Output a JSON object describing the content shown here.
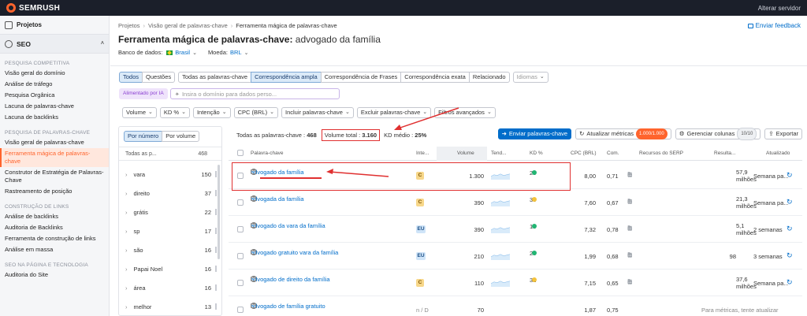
{
  "topbar": {
    "brand": "SEMRUSH",
    "server_label": "Alterar servidor"
  },
  "sidebar": {
    "projects": "Projetos",
    "seo": "SEO",
    "sections": [
      {
        "title": "PESQUISA COMPETITIVA",
        "items": [
          "Visão geral do domínio",
          "Análise de tráfego",
          "Pesquisa Orgânica",
          "Lacuna de palavras-chave",
          "Lacuna de backlinks"
        ]
      },
      {
        "title": "PESQUISA DE PALAVRAS-CHAVE",
        "items": [
          "Visão geral de palavras-chave",
          "Ferramenta mágica de palavras-chave",
          "Construtor de Estratégia de Palavras-Chave",
          "Rastreamento de posição"
        ]
      },
      {
        "title": "CONSTRUÇÃO DE LINKS",
        "items": [
          "Análise de backlinks",
          "Auditoria de Backlinks",
          "Ferramenta de construção de links",
          "Análise em massa"
        ]
      },
      {
        "title": "SEO NA PÁGINA E TECNOLOGIA",
        "items": [
          "Auditoria do Site"
        ]
      }
    ]
  },
  "header": {
    "breadcrumbs": [
      "Projetos",
      "Visão geral de palavras-chave",
      "Ferramenta mágica de palavras-chave"
    ],
    "feedback": "Enviar feedback",
    "title": "Ferramenta mágica de palavras-chave:",
    "keyword": "advogado da família",
    "db_label": "Banco de dados:",
    "db_value": "Brasil",
    "currency_label": "Moeda:",
    "currency_value": "BRL"
  },
  "filters": {
    "group1": [
      "Todos",
      "Questões"
    ],
    "group2": [
      "Todas as palavras-chave",
      "Correspondência ampla",
      "Correspondência de Frases",
      "Correspondência exata",
      "Relacionado"
    ],
    "languages": "Idiomas",
    "ai_badge": "Alimentado por IA",
    "ai_placeholder": "Insira o domínio para dados perso...",
    "row2": [
      "Volume",
      "KD %",
      "Intenção",
      "CPC (BRL)",
      "Incluir palavras-chave",
      "Excluir palavras-chave",
      "Filtros avançados"
    ]
  },
  "left_panel": {
    "toggle": [
      "Por número",
      "Por volume"
    ],
    "head_label": "Todas as p...",
    "head_count": "468",
    "items": [
      {
        "label": "vara",
        "count": "150"
      },
      {
        "label": "direito",
        "count": "37"
      },
      {
        "label": "grátis",
        "count": "22"
      },
      {
        "label": "sp",
        "count": "17"
      },
      {
        "label": "são",
        "count": "16"
      },
      {
        "label": "Papai Noel",
        "count": "16"
      },
      {
        "label": "área",
        "count": "16"
      },
      {
        "label": "melhor",
        "count": "13"
      }
    ]
  },
  "table": {
    "total_label": "Todas as palavras-chave :",
    "total_value": "468",
    "volume_label": "Volume total :",
    "volume_value": "3.160",
    "kd_label": "KD médio :",
    "kd_value": "25%",
    "send_button": "Enviar palavras-chave",
    "update_button": "Atualizar métricas",
    "update_badge": "1.000/1.000",
    "columns_button": "Gerenciar colunas",
    "columns_badge": "10/10",
    "export_button": "Exportar",
    "headers": [
      "Palavra-chave",
      "Inte...",
      "Volume",
      "Tend...",
      "KD %",
      "CPC (BRL)",
      "Com.",
      "Recursos do SERP",
      "Resulta...",
      "Atualizado"
    ],
    "rows": [
      {
        "keyword": "advogado da família",
        "intent": "C",
        "volume": "1.300",
        "kd": "25",
        "kd_color": "#22b573",
        "cpc": "8,00",
        "com": "0,71",
        "results": "57,9",
        "results_unit": "milhões",
        "updated": "Semana pa..."
      },
      {
        "keyword": "advogada da família",
        "intent": "C",
        "volume": "390",
        "kd": "33",
        "kd_color": "#f5c33b",
        "cpc": "7,60",
        "com": "0,67",
        "results": "21,3",
        "results_unit": "milhões",
        "updated": "Semana pa..."
      },
      {
        "keyword": "advogado da vara da família",
        "intent": "EU",
        "volume": "390",
        "kd": "18",
        "kd_color": "#22b573",
        "cpc": "7,32",
        "com": "0,78",
        "results": "5,1",
        "results_unit": "milhões",
        "updated": "2 semanas"
      },
      {
        "keyword": "advogado gratuito vara da família",
        "intent": "EU",
        "volume": "210",
        "kd": "20",
        "kd_color": "#22b573",
        "cpc": "1,99",
        "com": "0,68",
        "results": "98",
        "results_unit": "",
        "updated": "3 semanas"
      },
      {
        "keyword": "advogado de direito da família",
        "intent": "C",
        "volume": "110",
        "kd": "31",
        "kd_color": "#f5c33b",
        "cpc": "7,15",
        "com": "0,65",
        "results": "37,6",
        "results_unit": "milhões",
        "updated": "Semana pa..."
      },
      {
        "keyword": "advogado de família gratuito",
        "intent": "n / D",
        "volume": "70",
        "kd": "",
        "kd_color": "",
        "cpc": "1,87",
        "com": "0,75",
        "results": "Para métricas, tente atualizar",
        "results_unit": "",
        "updated": ""
      }
    ]
  }
}
